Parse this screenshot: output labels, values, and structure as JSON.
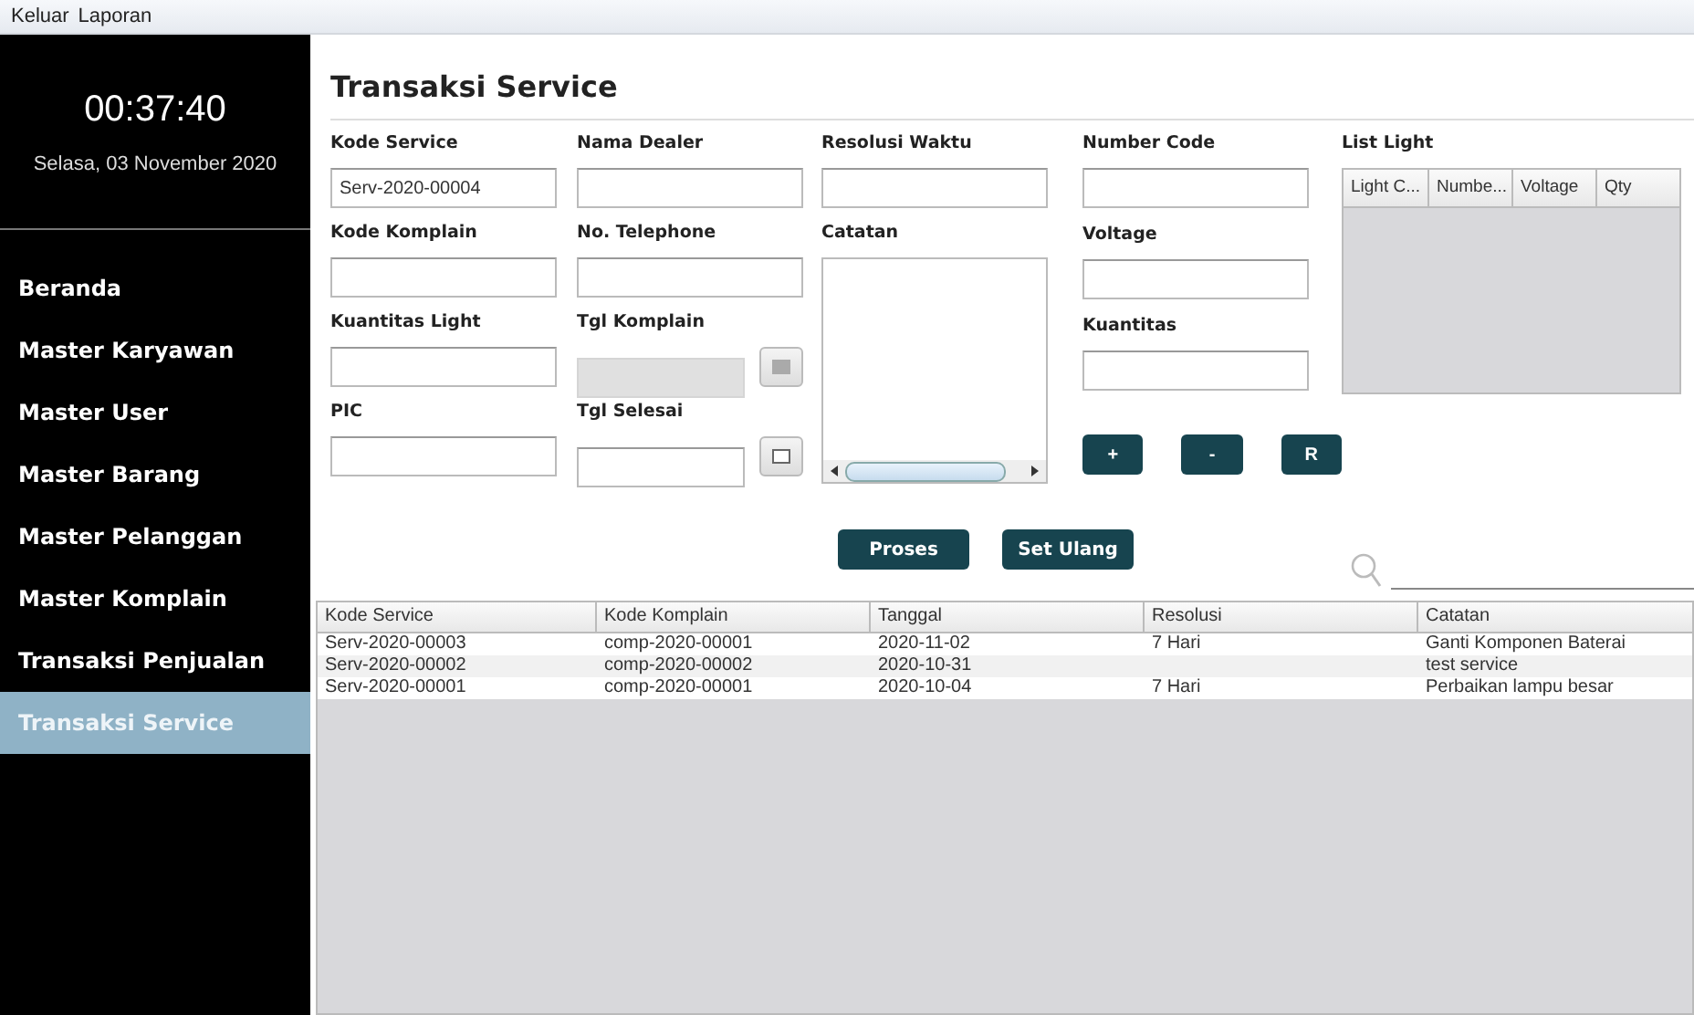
{
  "menu": [
    "Keluar",
    "Laporan"
  ],
  "sidebar": {
    "time": "00:37:40",
    "date": "Selasa, 03 November 2020",
    "items": [
      {
        "label": "Beranda",
        "selected": false
      },
      {
        "label": "Master Karyawan",
        "selected": false
      },
      {
        "label": "Master User",
        "selected": false
      },
      {
        "label": "Master Barang",
        "selected": false
      },
      {
        "label": "Master Pelanggan",
        "selected": false
      },
      {
        "label": "Master Komplain",
        "selected": false
      },
      {
        "label": "Transaksi Penjualan",
        "selected": false
      },
      {
        "label": "Transaksi Service",
        "selected": true
      }
    ]
  },
  "title": "Transaksi Service",
  "form_columns": [
    [
      {
        "label": "Kode Service",
        "value": "Serv-2020-00004",
        "kind": "text",
        "disabled": false
      },
      {
        "label": "Kode Komplain",
        "kind": "text",
        "disabled": false
      },
      {
        "label": "Kuantitas Light",
        "kind": "text",
        "disabled": false
      },
      {
        "label": "PIC",
        "kind": "text",
        "disabled": false
      }
    ],
    [
      {
        "label": "Nama Dealer",
        "kind": "text",
        "disabled": false
      },
      {
        "label": "No. Telephone",
        "kind": "text",
        "disabled": false
      },
      {
        "label": "Tgl Komplain",
        "kind": "date",
        "disabled": true
      },
      {
        "label": "Tgl Selesai",
        "kind": "date",
        "disabled": false
      }
    ],
    [
      {
        "label": "Resolusi Waktu",
        "kind": "text",
        "disabled": false
      },
      {
        "label": "Catatan",
        "kind": "textarea",
        "disabled": false
      }
    ],
    [
      {
        "label": "Number Code",
        "kind": "text",
        "disabled": false
      },
      {
        "label": "Voltage",
        "kind": "text",
        "disabled": false
      },
      {
        "label": "Kuantitas",
        "kind": "text",
        "disabled": false
      }
    ]
  ],
  "small_buttons": [
    "+",
    "-",
    "R"
  ],
  "list_light": {
    "label": "List Light",
    "columns": [
      "Light C...",
      "Numbe...",
      "Voltage",
      "Qty"
    ]
  },
  "action_buttons": [
    "Proses",
    "Set Ulang"
  ],
  "table": {
    "columns": [
      "Kode Service",
      "Kode Komplain",
      "Tanggal",
      "Resolusi",
      "Catatan"
    ],
    "rows": [
      [
        "Serv-2020-00003",
        "comp-2020-00001",
        "2020-11-02",
        "7 Hari",
        "Ganti Komponen Baterai"
      ],
      [
        "Serv-2020-00002",
        "comp-2020-00002",
        "2020-10-31",
        "",
        "test service"
      ],
      [
        "Serv-2020-00001",
        "comp-2020-00001",
        "2020-10-04",
        "7 Hari",
        "Perbaikan lampu besar"
      ]
    ]
  }
}
